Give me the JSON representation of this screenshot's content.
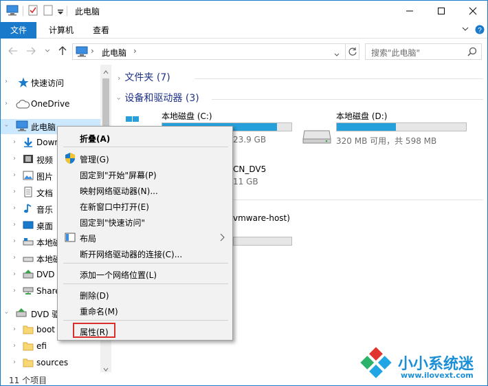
{
  "window": {
    "title": "此电脑"
  },
  "ribbon": {
    "tabs": [
      "文件",
      "计算机",
      "查看"
    ]
  },
  "address": {
    "path": "此电脑",
    "separator": "›"
  },
  "search": {
    "placeholder": "搜索\"此电脑\""
  },
  "nav": {
    "items": [
      {
        "label": "快速访问",
        "icon": "star-icon"
      },
      {
        "label": "OneDrive",
        "icon": "cloud-icon"
      },
      {
        "label": "此电脑",
        "icon": "computer-icon"
      },
      {
        "label": "Down",
        "icon": "download-icon"
      },
      {
        "label": "视频",
        "icon": "video-icon"
      },
      {
        "label": "图片",
        "icon": "picture-icon"
      },
      {
        "label": "文档",
        "icon": "document-icon"
      },
      {
        "label": "音乐",
        "icon": "music-icon"
      },
      {
        "label": "桌面",
        "icon": "desktop-icon"
      },
      {
        "label": "本地磁",
        "icon": "drive-icon"
      },
      {
        "label": "本地磁",
        "icon": "drive-icon"
      },
      {
        "label": "DVD",
        "icon": "dvd-icon"
      },
      {
        "label": "Share",
        "icon": "network-drive-icon"
      },
      {
        "label": "DVD 驱",
        "icon": "dvd-icon"
      },
      {
        "label": "boot",
        "icon": "folder-icon"
      },
      {
        "label": "efi",
        "icon": "folder-icon"
      },
      {
        "label": "sources",
        "icon": "folder-icon"
      }
    ]
  },
  "content": {
    "groups": [
      {
        "label": "文件夹 (7)"
      },
      {
        "label": "设备和驱动器 (3)"
      }
    ],
    "drives": [
      {
        "name": "本地磁盘 (C:)",
        "free": "23.9 GB",
        "used_fraction": 0.89
      },
      {
        "name": "本地磁盘 (D:)",
        "free": "320 MB 可用，共 598 MB",
        "used_fraction": 0.46
      }
    ],
    "dvd": {
      "name": "CN_DV5",
      "free": "11 GB"
    },
    "network": {
      "name": "vmware-host)"
    }
  },
  "status": {
    "count": "11 个项目"
  },
  "context_menu": {
    "items": [
      {
        "label": "折叠(A)",
        "bold": true
      },
      {
        "label": "管理(G)",
        "icon": "shield-icon"
      },
      {
        "label": "固定到\"开始\"屏幕(P)"
      },
      {
        "label": "映射网络驱动器(N)..."
      },
      {
        "label": "在新窗口中打开(E)"
      },
      {
        "label": "固定到\"快速访问\""
      },
      {
        "label": "布局",
        "icon": "layout-icon",
        "submenu": true
      },
      {
        "label": "断开网络驱动器的连接(C)..."
      },
      {
        "label": "添加一个网络位置(L)"
      },
      {
        "label": "删除(D)"
      },
      {
        "label": "重命名(M)"
      },
      {
        "label": "属性(R)",
        "highlighted": true
      }
    ]
  },
  "watermark": {
    "name": "小小系统迷",
    "url": "www.ilovext.com"
  },
  "colors": {
    "accent": "#1979ca",
    "drive_fill": "#26a0da",
    "highlight_box": "#d9302d",
    "group_title": "#1e3287"
  }
}
